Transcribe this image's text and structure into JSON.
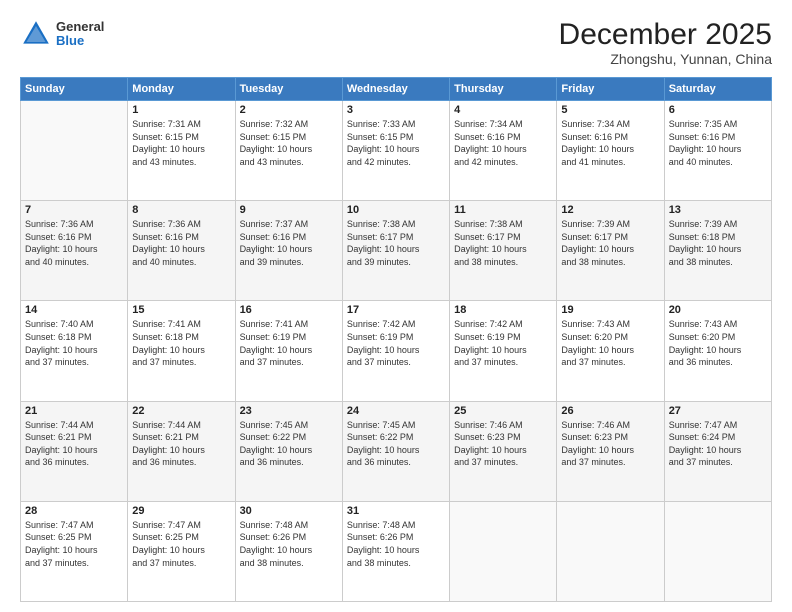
{
  "header": {
    "logo_general": "General",
    "logo_blue": "Blue",
    "title": "December 2025",
    "subtitle": "Zhongshu, Yunnan, China"
  },
  "calendar": {
    "days_of_week": [
      "Sunday",
      "Monday",
      "Tuesday",
      "Wednesday",
      "Thursday",
      "Friday",
      "Saturday"
    ],
    "weeks": [
      [
        {
          "day": "",
          "info": ""
        },
        {
          "day": "1",
          "info": "Sunrise: 7:31 AM\nSunset: 6:15 PM\nDaylight: 10 hours\nand 43 minutes."
        },
        {
          "day": "2",
          "info": "Sunrise: 7:32 AM\nSunset: 6:15 PM\nDaylight: 10 hours\nand 43 minutes."
        },
        {
          "day": "3",
          "info": "Sunrise: 7:33 AM\nSunset: 6:15 PM\nDaylight: 10 hours\nand 42 minutes."
        },
        {
          "day": "4",
          "info": "Sunrise: 7:34 AM\nSunset: 6:16 PM\nDaylight: 10 hours\nand 42 minutes."
        },
        {
          "day": "5",
          "info": "Sunrise: 7:34 AM\nSunset: 6:16 PM\nDaylight: 10 hours\nand 41 minutes."
        },
        {
          "day": "6",
          "info": "Sunrise: 7:35 AM\nSunset: 6:16 PM\nDaylight: 10 hours\nand 40 minutes."
        }
      ],
      [
        {
          "day": "7",
          "info": "Sunrise: 7:36 AM\nSunset: 6:16 PM\nDaylight: 10 hours\nand 40 minutes."
        },
        {
          "day": "8",
          "info": "Sunrise: 7:36 AM\nSunset: 6:16 PM\nDaylight: 10 hours\nand 40 minutes."
        },
        {
          "day": "9",
          "info": "Sunrise: 7:37 AM\nSunset: 6:16 PM\nDaylight: 10 hours\nand 39 minutes."
        },
        {
          "day": "10",
          "info": "Sunrise: 7:38 AM\nSunset: 6:17 PM\nDaylight: 10 hours\nand 39 minutes."
        },
        {
          "day": "11",
          "info": "Sunrise: 7:38 AM\nSunset: 6:17 PM\nDaylight: 10 hours\nand 38 minutes."
        },
        {
          "day": "12",
          "info": "Sunrise: 7:39 AM\nSunset: 6:17 PM\nDaylight: 10 hours\nand 38 minutes."
        },
        {
          "day": "13",
          "info": "Sunrise: 7:39 AM\nSunset: 6:18 PM\nDaylight: 10 hours\nand 38 minutes."
        }
      ],
      [
        {
          "day": "14",
          "info": "Sunrise: 7:40 AM\nSunset: 6:18 PM\nDaylight: 10 hours\nand 37 minutes."
        },
        {
          "day": "15",
          "info": "Sunrise: 7:41 AM\nSunset: 6:18 PM\nDaylight: 10 hours\nand 37 minutes."
        },
        {
          "day": "16",
          "info": "Sunrise: 7:41 AM\nSunset: 6:19 PM\nDaylight: 10 hours\nand 37 minutes."
        },
        {
          "day": "17",
          "info": "Sunrise: 7:42 AM\nSunset: 6:19 PM\nDaylight: 10 hours\nand 37 minutes."
        },
        {
          "day": "18",
          "info": "Sunrise: 7:42 AM\nSunset: 6:19 PM\nDaylight: 10 hours\nand 37 minutes."
        },
        {
          "day": "19",
          "info": "Sunrise: 7:43 AM\nSunset: 6:20 PM\nDaylight: 10 hours\nand 37 minutes."
        },
        {
          "day": "20",
          "info": "Sunrise: 7:43 AM\nSunset: 6:20 PM\nDaylight: 10 hours\nand 36 minutes."
        }
      ],
      [
        {
          "day": "21",
          "info": "Sunrise: 7:44 AM\nSunset: 6:21 PM\nDaylight: 10 hours\nand 36 minutes."
        },
        {
          "day": "22",
          "info": "Sunrise: 7:44 AM\nSunset: 6:21 PM\nDaylight: 10 hours\nand 36 minutes."
        },
        {
          "day": "23",
          "info": "Sunrise: 7:45 AM\nSunset: 6:22 PM\nDaylight: 10 hours\nand 36 minutes."
        },
        {
          "day": "24",
          "info": "Sunrise: 7:45 AM\nSunset: 6:22 PM\nDaylight: 10 hours\nand 36 minutes."
        },
        {
          "day": "25",
          "info": "Sunrise: 7:46 AM\nSunset: 6:23 PM\nDaylight: 10 hours\nand 37 minutes."
        },
        {
          "day": "26",
          "info": "Sunrise: 7:46 AM\nSunset: 6:23 PM\nDaylight: 10 hours\nand 37 minutes."
        },
        {
          "day": "27",
          "info": "Sunrise: 7:47 AM\nSunset: 6:24 PM\nDaylight: 10 hours\nand 37 minutes."
        }
      ],
      [
        {
          "day": "28",
          "info": "Sunrise: 7:47 AM\nSunset: 6:25 PM\nDaylight: 10 hours\nand 37 minutes."
        },
        {
          "day": "29",
          "info": "Sunrise: 7:47 AM\nSunset: 6:25 PM\nDaylight: 10 hours\nand 37 minutes."
        },
        {
          "day": "30",
          "info": "Sunrise: 7:48 AM\nSunset: 6:26 PM\nDaylight: 10 hours\nand 38 minutes."
        },
        {
          "day": "31",
          "info": "Sunrise: 7:48 AM\nSunset: 6:26 PM\nDaylight: 10 hours\nand 38 minutes."
        },
        {
          "day": "",
          "info": ""
        },
        {
          "day": "",
          "info": ""
        },
        {
          "day": "",
          "info": ""
        }
      ]
    ]
  }
}
